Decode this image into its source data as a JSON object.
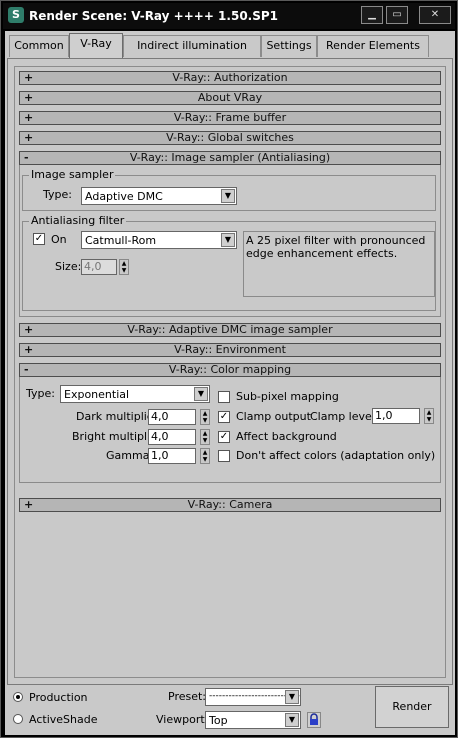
{
  "window": {
    "title": "Render Scene: V-Ray ++++ 1.50.SP1",
    "icon_glyph": "S",
    "controls": [
      "minimize-icon",
      "maximize-icon",
      "close-icon"
    ]
  },
  "tabs": [
    "Common",
    "V-Ray",
    "Indirect illumination",
    "Settings",
    "Render Elements"
  ],
  "active_tab": "V-Ray",
  "rollouts": {
    "authorization": "V-Ray:: Authorization",
    "about": "About VRay",
    "frame_buffer": "V-Ray:: Frame buffer",
    "global_switches": "V-Ray:: Global switches",
    "image_sampler": "V-Ray:: Image sampler (Antialiasing)",
    "adaptive_dmc": "V-Ray:: Adaptive DMC image sampler",
    "environment": "V-Ray:: Environment",
    "color_mapping": "V-Ray:: Color mapping",
    "camera": "V-Ray:: Camera",
    "collapsed_sign": "+",
    "expanded_sign": "-"
  },
  "image_sampler": {
    "group_label": "Image sampler",
    "type_label": "Type:",
    "type_value": "Adaptive DMC",
    "aa_group_label": "Antialiasing filter",
    "on_label": "On",
    "on_checked": true,
    "filter_value": "Catmull-Rom",
    "filter_description": "A 25 pixel filter with pronounced edge enhancement effects.",
    "size_label": "Size:",
    "size_value": "4,0"
  },
  "color_mapping": {
    "type_label": "Type:",
    "type_value": "Exponential",
    "dark_multiplier_label": "Dark multiplier:",
    "dark_multiplier_value": "4,0",
    "bright_multiplier_label": "Bright multiplier:",
    "bright_multiplier_value": "4,0",
    "gamma_label": "Gamma:",
    "gamma_value": "1,0",
    "subpixel_label": "Sub-pixel mapping",
    "subpixel_checked": false,
    "clamp_output_label": "Clamp output",
    "clamp_output_checked": true,
    "clamp_level_label": "Clamp level:",
    "clamp_level_value": "1,0",
    "affect_background_label": "Affect background",
    "affect_background_checked": true,
    "dont_affect_label": "Don't affect colors (adaptation only)",
    "dont_affect_checked": false
  },
  "footer": {
    "production_label": "Production",
    "activeshade_label": "ActiveShade",
    "selected_mode": "Production",
    "preset_label": "Preset:",
    "preset_value": "----------------------------",
    "viewport_label": "Viewport:",
    "viewport_value": "Top",
    "render_label": "Render"
  },
  "icons": {
    "dropdown": "chevron-down-icon",
    "spinner": "spinner-arrows-icon",
    "lock": "lock-icon",
    "check_glyph": "✓"
  }
}
